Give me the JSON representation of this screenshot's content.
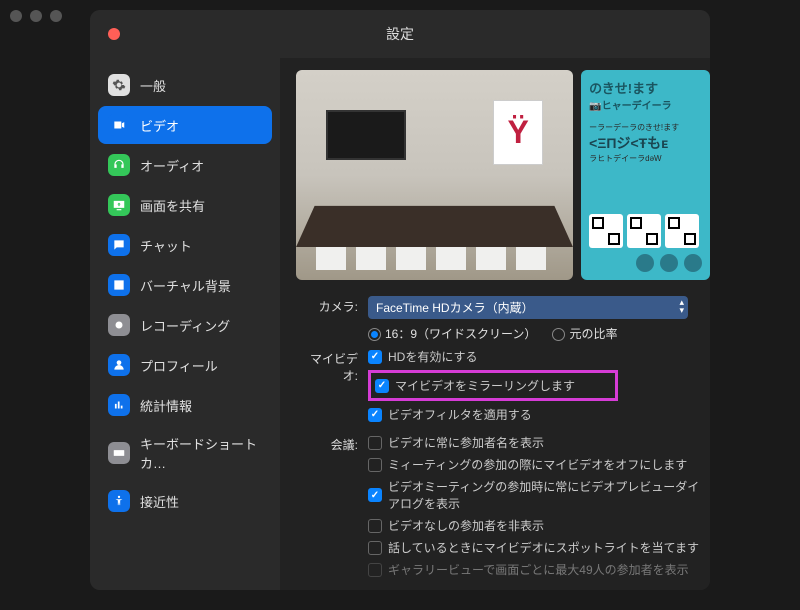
{
  "window": {
    "title": "設定"
  },
  "sidebar": {
    "items": [
      {
        "label": "一般"
      },
      {
        "label": "ビデオ"
      },
      {
        "label": "オーディオ"
      },
      {
        "label": "画面を共有"
      },
      {
        "label": "チャット"
      },
      {
        "label": "バーチャル背景"
      },
      {
        "label": "レコーディング"
      },
      {
        "label": "プロフィール"
      },
      {
        "label": "統計情報"
      },
      {
        "label": "キーボードショートカ…"
      },
      {
        "label": "接近性"
      }
    ]
  },
  "camera": {
    "label": "カメラ:",
    "value": "FaceTime HDカメラ（内蔵）",
    "ratio_wide": "16：9（ワイドスクリーン）",
    "ratio_orig": "元の比率"
  },
  "myvideo": {
    "label": "マイビデオ:",
    "hd": "HDを有効にする",
    "mirror": "マイビデオをミラーリングします",
    "filter": "ビデオフィルタを適用する"
  },
  "meeting": {
    "label": "会議:",
    "show_name": "ビデオに常に参加者名を表示",
    "off_on_join": "ミィーティングの参加の際にマイビデオをオフにします",
    "preview_dialog": "ビデオミーティングの参加時に常にビデオプレビューダイアログを表示",
    "hide_novideo": "ビデオなしの参加者を非表示",
    "spotlight": "話しているときにマイビデオにスポットライトを当てます",
    "gallery49": "ギャラリービューで画面ごとに最大49人の参加者を表示"
  }
}
